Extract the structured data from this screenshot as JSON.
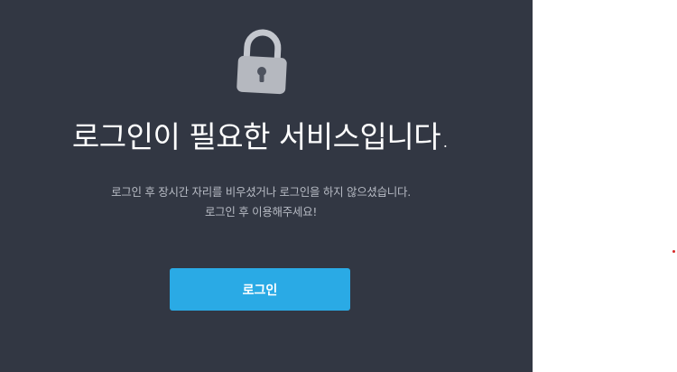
{
  "lock": {
    "icon": "padlock-icon"
  },
  "title": "로그인이 필요한 서비스입니다.",
  "description": {
    "line1": "로그인 후 장시간 자리를 비우셨거나 로그인을 하지 않으셨습니다.",
    "line2": "로그인 후 이용해주세요!"
  },
  "login_button": {
    "label": "로그인",
    "color": "#2aaae5"
  },
  "colors": {
    "panel_bg": "#323743",
    "page_bg": "#ffffff"
  }
}
